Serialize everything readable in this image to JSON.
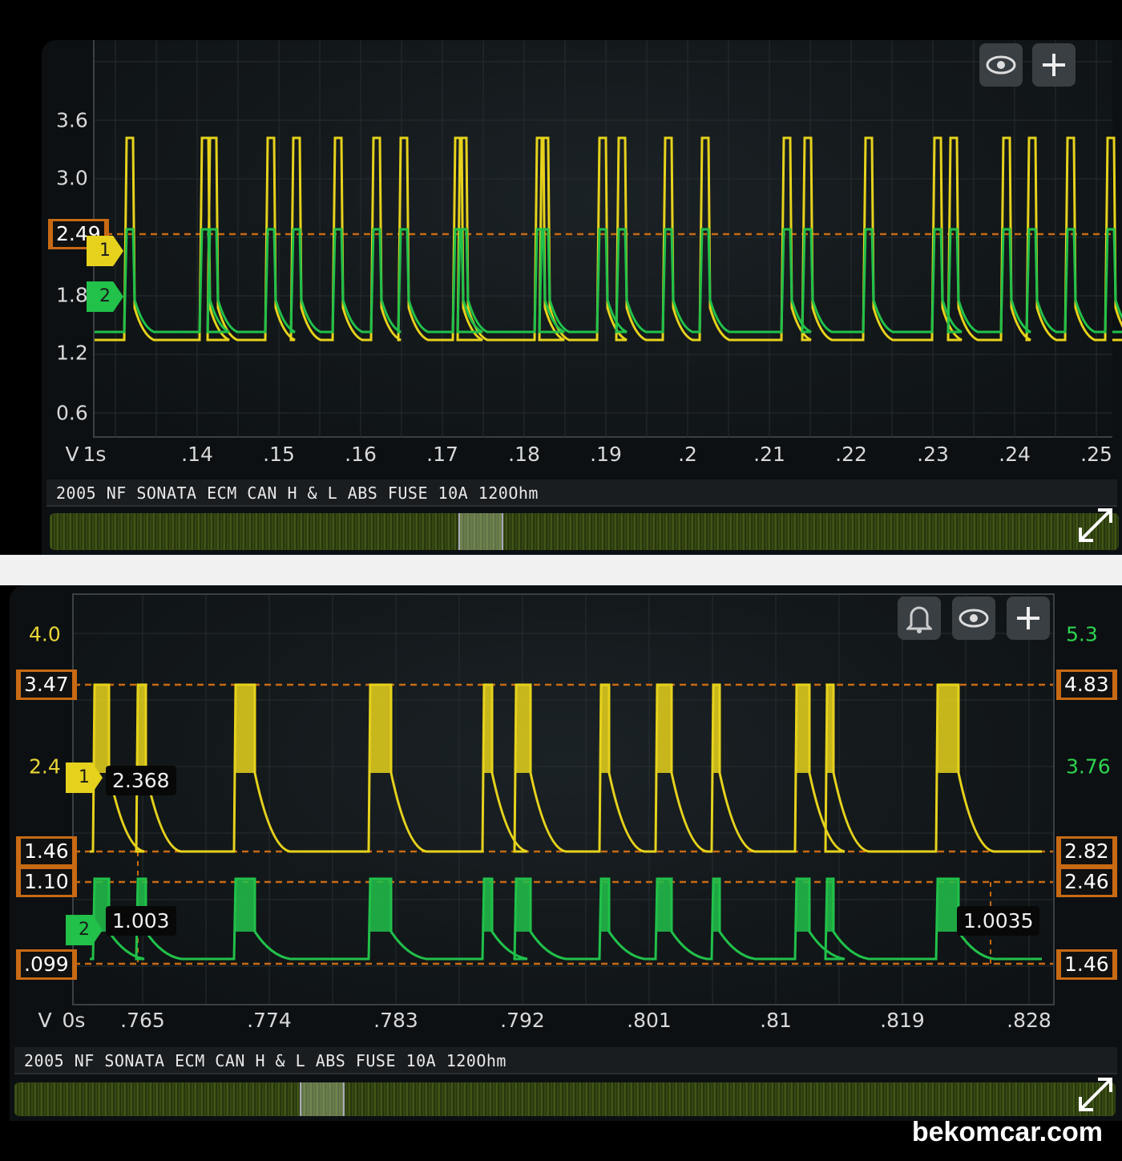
{
  "top": {
    "title": "2005 NF SONATA ECM CAN H & L ABS FUSE 10A 120Ohm",
    "y_axis_unit": "V",
    "time_div": "1s",
    "y_ticks": [
      "3.6",
      "3.0",
      "1.8",
      "1.2",
      "0.6"
    ],
    "x_ticks": [
      ".14",
      ".15",
      ".16",
      ".17",
      ".18",
      ".19",
      ".2",
      ".21",
      ".22",
      ".23",
      ".24",
      ".25"
    ],
    "cursor_value": "2.49",
    "channel_1_label": "1",
    "channel_2_label": "2",
    "buttons": {
      "eye": "eye-icon",
      "add": "plus-icon",
      "expand": "expand-icon"
    }
  },
  "bottom": {
    "title": "2005 NF SONATA ECM CAN H & L ABS FUSE 10A 120Ohm",
    "y_axis_unit": "V",
    "time_div": "0s",
    "y_ticks_left": [
      "4.0",
      "2.4"
    ],
    "y_ticks_right": [
      "3.76"
    ],
    "y_ticks_right_top_partial": "5.3",
    "x_ticks": [
      ".765",
      ".774",
      ".783",
      ".792",
      ".801",
      ".81",
      ".819",
      ".828"
    ],
    "left_markers": [
      "3.47",
      "1.46",
      "1.10",
      ".099"
    ],
    "right_markers": [
      "4.83",
      "2.82",
      "2.46",
      "1.46"
    ],
    "readouts": {
      "ch1": "2.368",
      "ch2": "1.003",
      "delta": "1.0035"
    },
    "channel_1_label": "1",
    "channel_2_label": "2",
    "buttons": {
      "bell": "bell-icon",
      "eye": "eye-icon",
      "add": "plus-icon",
      "expand": "expand-icon"
    }
  },
  "watermark": "bekomcar.com",
  "colors": {
    "ch1": "#e6d21c",
    "ch2": "#21c14a",
    "cursor": "#c86a14",
    "background": "#0c1013"
  }
}
